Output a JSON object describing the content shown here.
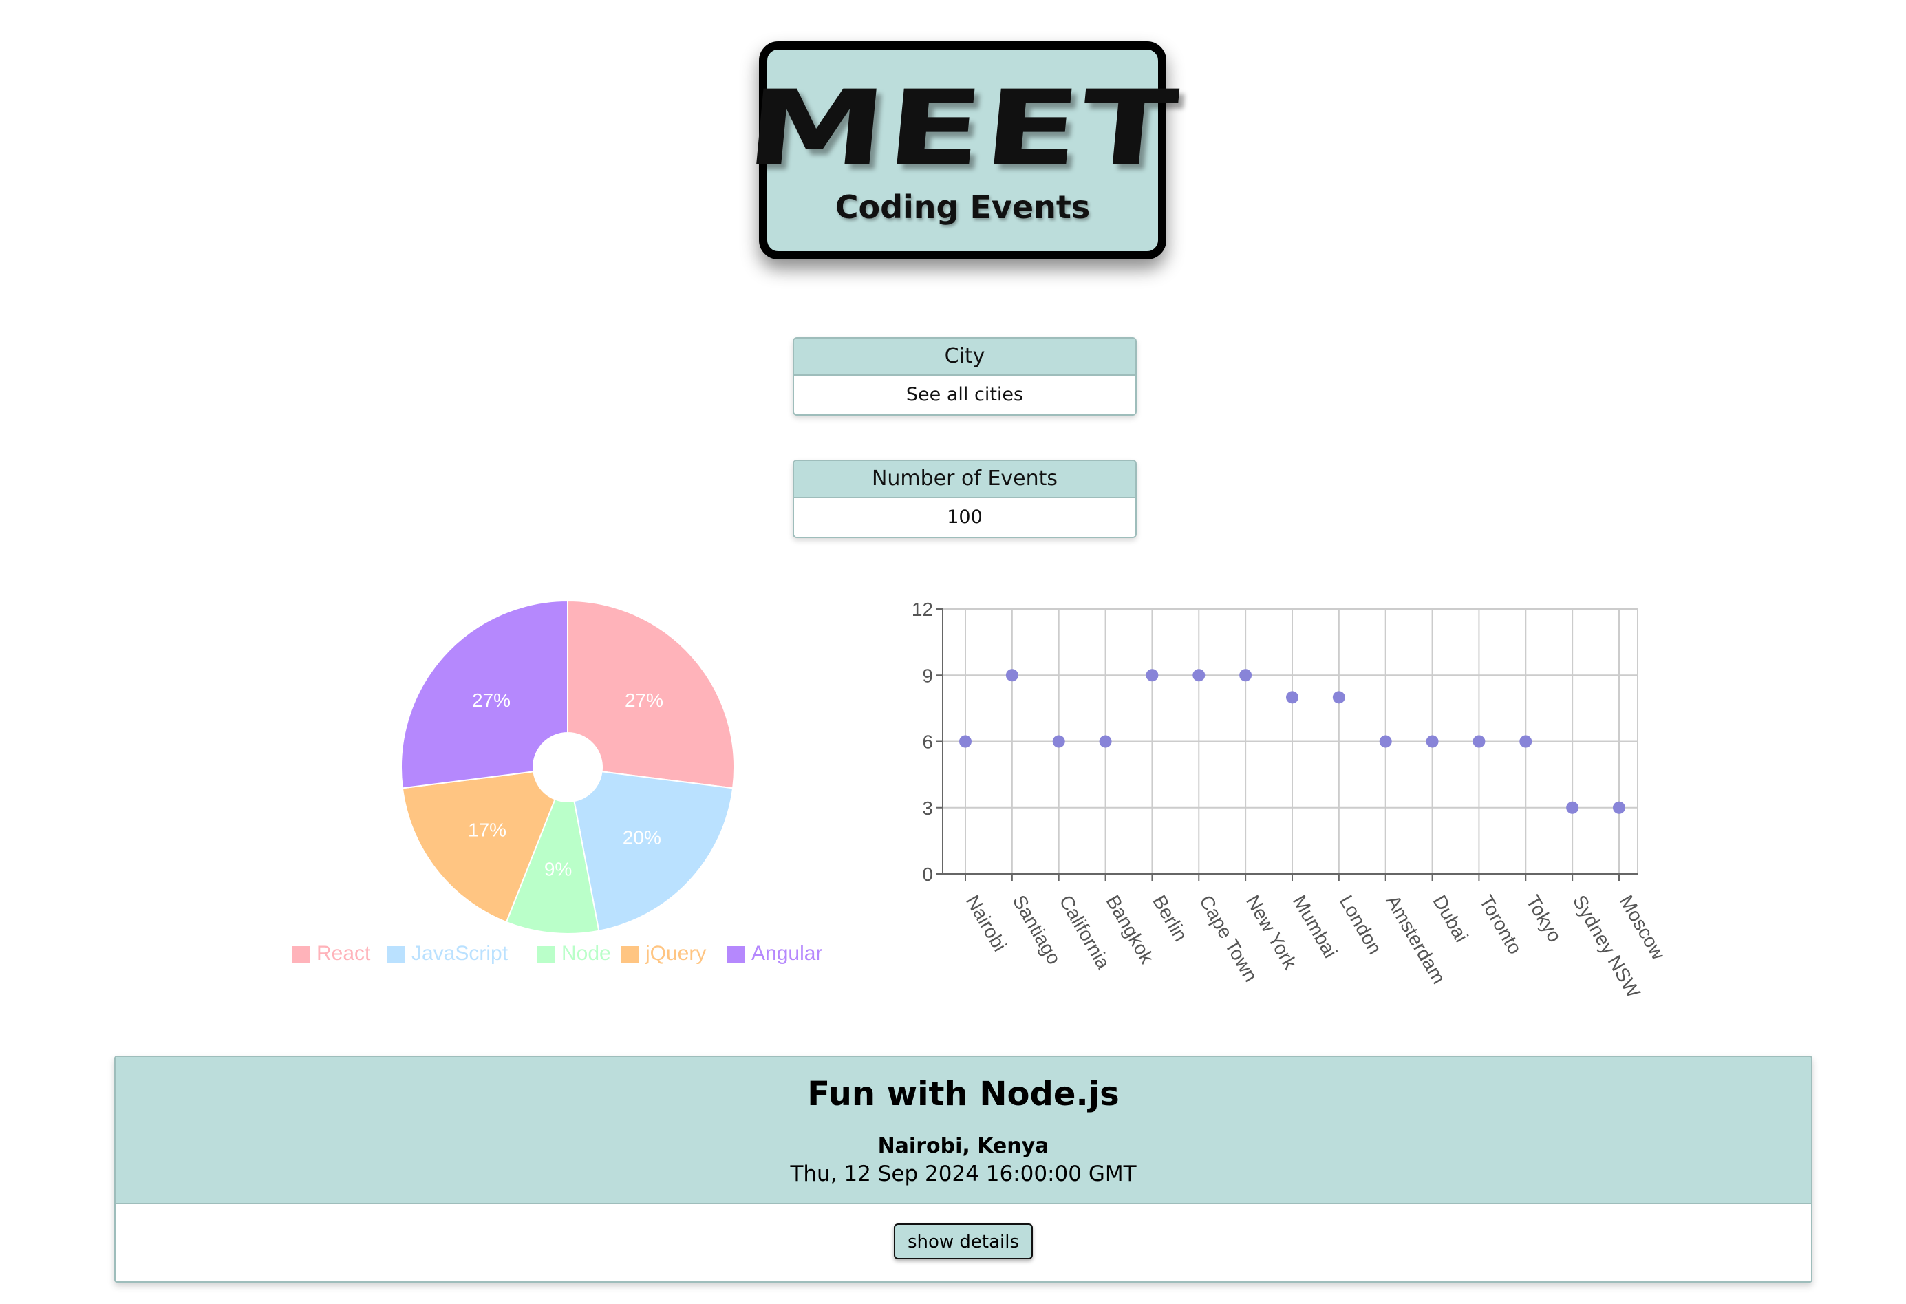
{
  "header": {
    "logo_text": "MEET",
    "subtitle": "Coding Events"
  },
  "filters": {
    "city": {
      "label": "City",
      "placeholder": "See all cities"
    },
    "number_of_events": {
      "label": "Number of Events",
      "value": "100"
    }
  },
  "colors": {
    "accent": "#bcdddb",
    "border": "#9ebdbb",
    "scatter_point": "#8884d8"
  },
  "chart_data": [
    {
      "type": "pie",
      "title": "",
      "slices": [
        {
          "name": "React",
          "value": 27,
          "label": "27%",
          "color": "#ffb3ba"
        },
        {
          "name": "JavaScript",
          "value": 20,
          "label": "20%",
          "color": "#bae1ff"
        },
        {
          "name": "Node",
          "value": 9,
          "label": "9%",
          "color": "#baffc9"
        },
        {
          "name": "jQuery",
          "value": 17,
          "label": "17%",
          "color": "#ffc582"
        },
        {
          "name": "Angular",
          "value": 27,
          "label": "27%",
          "color": "#b588fd"
        }
      ],
      "legend_position": "bottom"
    },
    {
      "type": "scatter",
      "title": "",
      "xlabel": "",
      "ylabel": "",
      "categories": [
        "Nairobi",
        "Santiago",
        "California",
        "Bangkok",
        "Berlin",
        "Cape Town",
        "New York",
        "Mumbai",
        "London",
        "Amsterdam",
        "Dubai",
        "Toronto",
        "Tokyo",
        "Sydney NSW",
        "Moscow"
      ],
      "values": [
        6,
        9,
        6,
        6,
        9,
        9,
        9,
        8,
        8,
        6,
        6,
        6,
        6,
        3,
        3
      ],
      "ylim": [
        0,
        12
      ],
      "yticks": [
        "0",
        "3",
        "6",
        "9",
        "12"
      ],
      "grid": true
    }
  ],
  "event": {
    "title": "Fun with Node.js",
    "location": "Nairobi, Kenya",
    "datetime": "Thu, 12 Sep 2024 16:00:00 GMT",
    "button_label": "show details"
  }
}
